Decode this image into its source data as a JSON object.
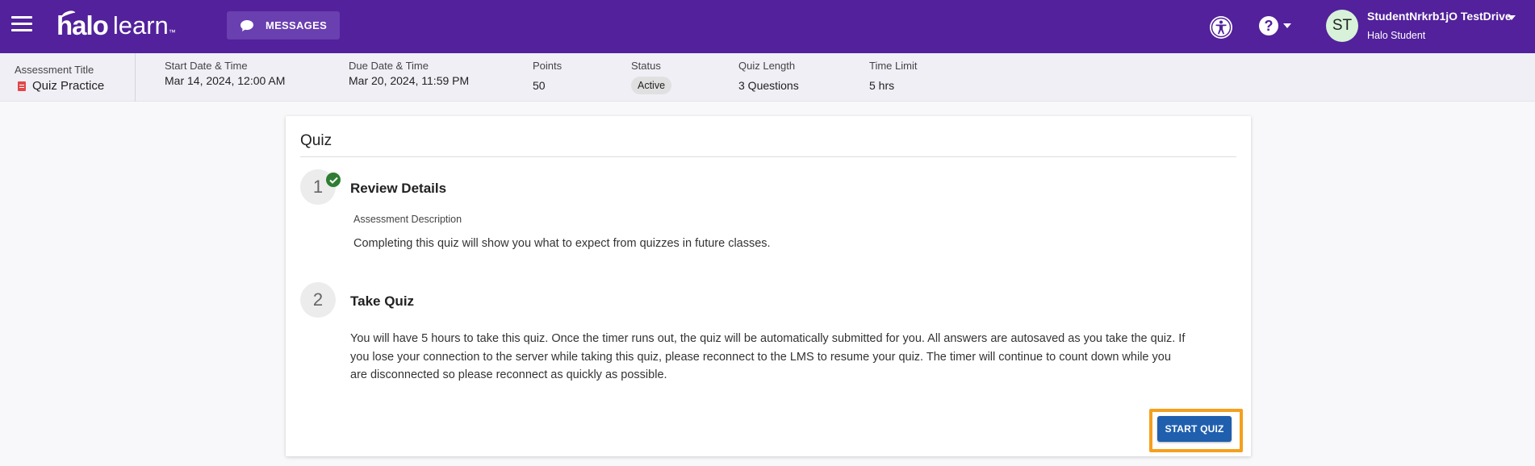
{
  "header": {
    "logo_main": "halo",
    "logo_sub": "learn",
    "logo_tm": "™",
    "messages_label": "MESSAGES",
    "user_initials": "ST",
    "user_name": "StudentNrkrb1jO TestDrive",
    "user_role": "Halo Student",
    "help_glyph": "?"
  },
  "assessment": {
    "title_label": "Assessment Title",
    "title_value": "Quiz Practice",
    "start_label": "Start Date & Time",
    "start_value": "Mar 14, 2024, 12:00 AM",
    "due_label": "Due Date & Time",
    "due_value": "Mar 20, 2024, 11:59 PM",
    "points_label": "Points",
    "points_value": "50",
    "status_label": "Status",
    "status_value": "Active",
    "length_label": "Quiz Length",
    "length_value": "3 Questions",
    "time_label": "Time Limit",
    "time_value": "5 hrs"
  },
  "card": {
    "title": "Quiz",
    "step1": {
      "number": "1",
      "heading": "Review Details",
      "desc_label": "Assessment Description",
      "desc_text": "Completing this quiz will show you what to expect from quizzes in future classes."
    },
    "step2": {
      "number": "2",
      "heading": "Take Quiz",
      "text": "You will have 5 hours to take this quiz. Once the timer runs out, the quiz will be automatically submitted for you. All answers are autosaved as you take the quiz. If you lose your connection to the server while taking this quiz, please reconnect to the LMS to resume your quiz. The timer will continue to count down while you are disconnected so please reconnect as quickly as possible."
    },
    "start_label": "START QUIZ"
  },
  "colors": {
    "brand_purple": "#52219b",
    "button_blue": "#1f5fae",
    "highlight_orange": "#f5a01d",
    "check_green": "#2e7d32"
  },
  "icons": [
    "menu-icon",
    "chat-bubble-icon",
    "accessibility-icon",
    "help-icon",
    "chevron-down-icon",
    "document-icon",
    "check-icon"
  ]
}
